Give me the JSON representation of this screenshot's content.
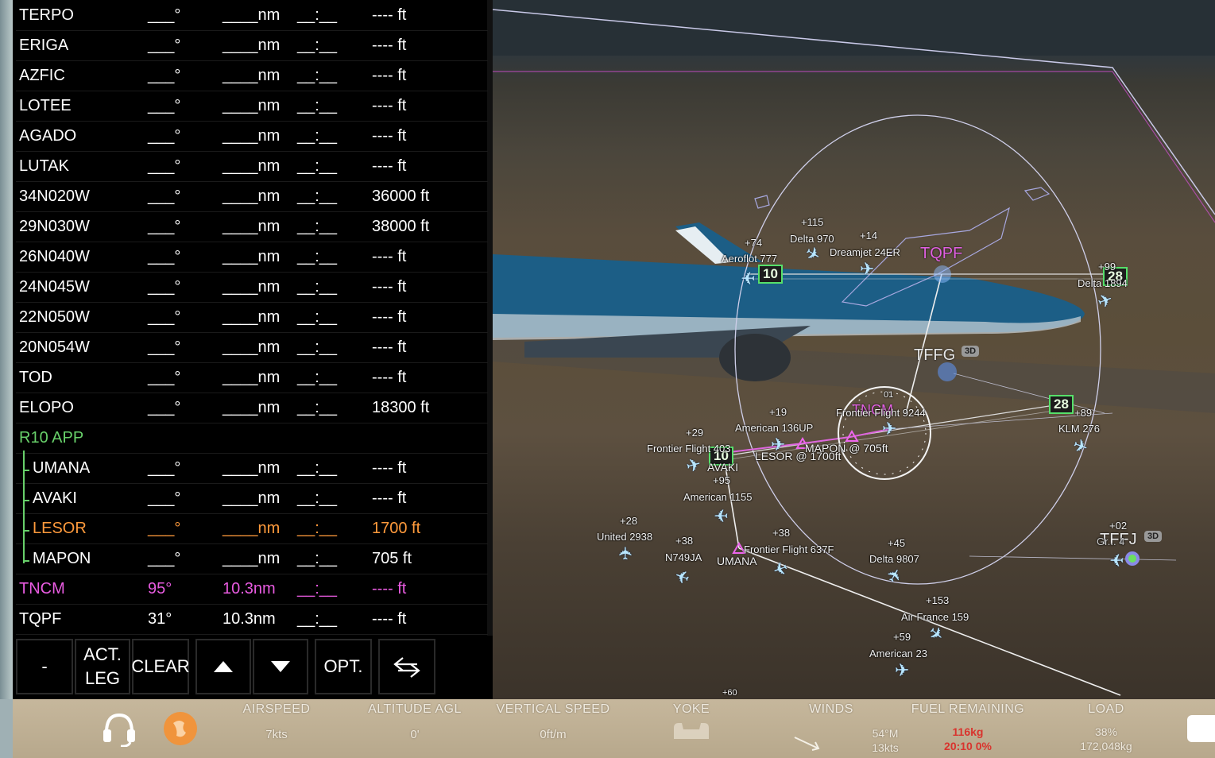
{
  "fms": {
    "rows": [
      {
        "name": "TERPO",
        "hdg": "___°",
        "dist": "____nm",
        "time": "__:__",
        "alt": "---- ft",
        "style": ""
      },
      {
        "name": "ERIGA",
        "hdg": "___°",
        "dist": "____nm",
        "time": "__:__",
        "alt": "---- ft",
        "style": ""
      },
      {
        "name": "AZFIC",
        "hdg": "___°",
        "dist": "____nm",
        "time": "__:__",
        "alt": "---- ft",
        "style": ""
      },
      {
        "name": "LOTEE",
        "hdg": "___°",
        "dist": "____nm",
        "time": "__:__",
        "alt": "---- ft",
        "style": ""
      },
      {
        "name": "AGADO",
        "hdg": "___°",
        "dist": "____nm",
        "time": "__:__",
        "alt": "---- ft",
        "style": ""
      },
      {
        "name": "LUTAK",
        "hdg": "___°",
        "dist": "____nm",
        "time": "__:__",
        "alt": "---- ft",
        "style": ""
      },
      {
        "name": "34N020W",
        "hdg": "___°",
        "dist": "____nm",
        "time": "__:__",
        "alt": "36000 ft",
        "style": ""
      },
      {
        "name": "29N030W",
        "hdg": "___°",
        "dist": "____nm",
        "time": "__:__",
        "alt": "38000 ft",
        "style": ""
      },
      {
        "name": "26N040W",
        "hdg": "___°",
        "dist": "____nm",
        "time": "__:__",
        "alt": "---- ft",
        "style": ""
      },
      {
        "name": "24N045W",
        "hdg": "___°",
        "dist": "____nm",
        "time": "__:__",
        "alt": "---- ft",
        "style": ""
      },
      {
        "name": "22N050W",
        "hdg": "___°",
        "dist": "____nm",
        "time": "__:__",
        "alt": "---- ft",
        "style": ""
      },
      {
        "name": "20N054W",
        "hdg": "___°",
        "dist": "____nm",
        "time": "__:__",
        "alt": "---- ft",
        "style": ""
      },
      {
        "name": "TOD",
        "hdg": "___°",
        "dist": "____nm",
        "time": "__:__",
        "alt": "---- ft",
        "style": ""
      },
      {
        "name": "ELOPO",
        "hdg": "___°",
        "dist": "____nm",
        "time": "__:__",
        "alt": "18300 ft",
        "style": ""
      },
      {
        "name": "R10 APP",
        "hdg": "",
        "dist": "",
        "time": "",
        "alt": "",
        "style": "green"
      },
      {
        "name": "UMANA",
        "hdg": "___°",
        "dist": "____nm",
        "time": "__:__",
        "alt": "---- ft",
        "style": "sub"
      },
      {
        "name": "AVAKI",
        "hdg": "___°",
        "dist": "____nm",
        "time": "__:__",
        "alt": "---- ft",
        "style": "sub"
      },
      {
        "name": "LESOR",
        "hdg": "___°",
        "dist": "____nm",
        "time": "__:__",
        "alt": "1700 ft",
        "style": "sub orange"
      },
      {
        "name": "MAPON",
        "hdg": "___°",
        "dist": "____nm",
        "time": "__:__",
        "alt": "705 ft",
        "style": "sub"
      },
      {
        "name": "TNCM",
        "hdg": "95°",
        "dist": "10.3nm",
        "time": "__:__",
        "alt": "---- ft",
        "style": "magenta"
      },
      {
        "name": "TQPF",
        "hdg": "31°",
        "dist": "10.3nm",
        "time": "__:__",
        "alt": "---- ft",
        "style": ""
      }
    ],
    "buttons": {
      "minus": "-",
      "act_leg_1": "ACT.",
      "act_leg_2": "LEG",
      "clear": "CLEAR",
      "opt": "OPT."
    }
  },
  "map": {
    "fixes": [
      {
        "id": "TQPF",
        "label": "TQPF",
        "color": "#e060e0"
      },
      {
        "id": "TFFG",
        "label": "TFFG",
        "color": "#e8e8e8"
      },
      {
        "id": "TFFJ",
        "label": "TFFJ",
        "color": "#e8e8e8"
      },
      {
        "id": "TNCM",
        "label": "TNCM",
        "color": "#e060e0"
      }
    ],
    "tag_3d": "3D",
    "runways": {
      "r10": "10",
      "r28": "28"
    },
    "waypoint_labels": {
      "avaki": "AVAKI",
      "umana": "UMANA",
      "lesor": "LESOR @ 1700ft",
      "mapon": "MAPON @ 705ft",
      "compass_north": "01"
    },
    "traffic": [
      {
        "delta": "+115",
        "name": "Delta 970"
      },
      {
        "delta": "+14",
        "name": "Dreamjet 24ER"
      },
      {
        "delta": "+74",
        "name": "Aeroflot 777"
      },
      {
        "delta": "+99",
        "name": "Delta 1894"
      },
      {
        "delta": "+19",
        "name": "American 136UP"
      },
      {
        "delta": "+29",
        "name": "Frontier Flight 403"
      },
      {
        "delta": "+89",
        "name": "KLM 276"
      },
      {
        "delta": "",
        "name": "Frontier Flight 9244"
      },
      {
        "delta": "+95",
        "name": "American 1155"
      },
      {
        "delta": "+28",
        "name": "United 2938"
      },
      {
        "delta": "+38",
        "name": "N749JA"
      },
      {
        "delta": "+38",
        "name": "Frontier Flight 637F"
      },
      {
        "delta": "+45",
        "name": "Delta 9807"
      },
      {
        "delta": "+02",
        "name": "Gr... 4"
      },
      {
        "delta": "+153",
        "name": "Air France 159"
      },
      {
        "delta": "+59",
        "name": "American 23"
      },
      {
        "delta": "+60",
        "name": ""
      }
    ]
  },
  "bar": {
    "airspeed": {
      "title": "AIRSPEED",
      "value": "7kts"
    },
    "altitude": {
      "title": "ALTITUDE AGL",
      "value": "0'"
    },
    "vspeed": {
      "title": "VERTICAL SPEED",
      "value": "0ft/m"
    },
    "yoke": {
      "title": "YOKE"
    },
    "winds": {
      "title": "WINDS",
      "dir": "54°M",
      "speed": "13kts"
    },
    "fuel": {
      "title": "FUEL REMAINING",
      "amount": "116kg",
      "time": "20:10 0%"
    },
    "load": {
      "title": "LOAD",
      "pct": "38%",
      "weight": "172,048kg"
    }
  }
}
